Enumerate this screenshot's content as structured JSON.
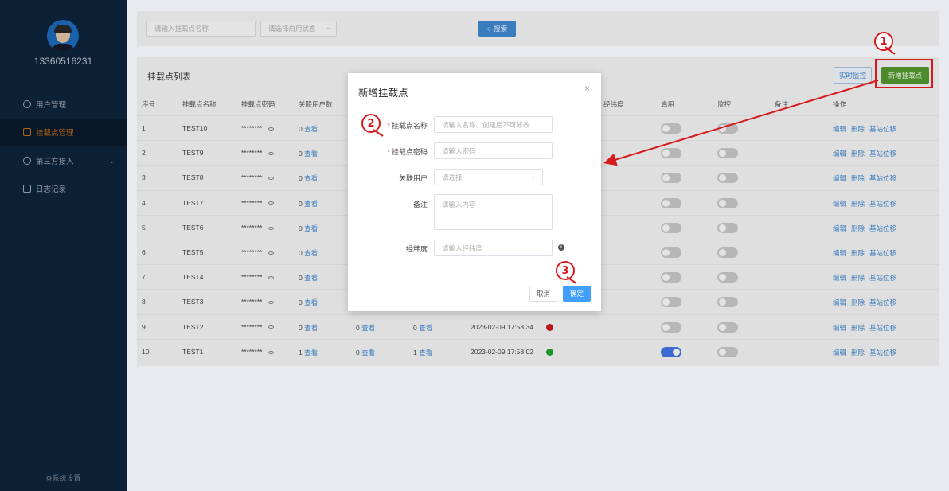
{
  "sidebar": {
    "phone": "13360516231",
    "items": [
      {
        "label": "用户管理",
        "icon": "user-icon"
      },
      {
        "label": "挂载点管理",
        "icon": "mount-icon"
      },
      {
        "label": "第三方接入",
        "icon": "globe-icon"
      },
      {
        "label": "日志记录",
        "icon": "log-icon"
      }
    ],
    "system_settings": "⚙系统设置"
  },
  "search": {
    "name_placeholder": "请输入挂载点名称",
    "status_placeholder": "请选择启用状态",
    "search_label": "搜索"
  },
  "list": {
    "title": "挂载点列表",
    "monitor_label": "实时监控",
    "add_label": "新增挂载点",
    "headers": [
      "序号",
      "挂载点名称",
      "挂载点密码",
      "关联用户数",
      "经纬度",
      "启用",
      "监控",
      "备注",
      "操作"
    ],
    "rows": [
      {
        "no": "1",
        "name": "TEST10",
        "pwd": "********",
        "users": "0",
        "view": "查看",
        "enabled": false
      },
      {
        "no": "2",
        "name": "TEST9",
        "pwd": "********",
        "users": "0",
        "view": "查看",
        "enabled": false
      },
      {
        "no": "3",
        "name": "TEST8",
        "pwd": "********",
        "users": "0",
        "view": "查看",
        "enabled": false
      },
      {
        "no": "4",
        "name": "TEST7",
        "pwd": "********",
        "users": "0",
        "view": "查看",
        "enabled": false
      },
      {
        "no": "5",
        "name": "TEST6",
        "pwd": "********",
        "users": "0",
        "view": "查看",
        "enabled": false
      },
      {
        "no": "6",
        "name": "TEST5",
        "pwd": "********",
        "users": "0",
        "view": "查看",
        "enabled": false
      },
      {
        "no": "7",
        "name": "TEST4",
        "pwd": "********",
        "users": "0",
        "view": "查看",
        "enabled": false
      },
      {
        "no": "8",
        "name": "TEST3",
        "pwd": "********",
        "users": "0",
        "view": "查看",
        "enabled": false
      },
      {
        "no": "9",
        "name": "TEST2",
        "pwd": "********",
        "users": "0",
        "view": "查看",
        "c5": "0",
        "c5view": "查看",
        "c6": "0",
        "c6view": "查看",
        "time": "2023-02-09 17:58:34",
        "status_color": "#c0181b",
        "enabled": false
      },
      {
        "no": "10",
        "name": "TEST1",
        "pwd": "********",
        "users": "1",
        "view": "查看",
        "c5": "0",
        "c5view": "查看",
        "c6": "1",
        "c6view": "查看",
        "time": "2023-02-09 17:58:02",
        "status_color": "#1a9a2a",
        "enabled": true
      }
    ],
    "actions": [
      "编辑",
      "删除",
      "基站位移"
    ]
  },
  "modal": {
    "title": "新增挂载点",
    "close": "×",
    "name_label": "挂载点名称",
    "name_placeholder": "请输入名称、创建后不可修改",
    "pwd_label": "挂载点密码",
    "pwd_placeholder": "请输入密码",
    "user_label": "关联用户",
    "user_placeholder": "请选择",
    "remark_label": "备注",
    "remark_placeholder": "请输入内容",
    "coord_label": "经纬度",
    "coord_placeholder": "请输入经纬度",
    "cancel_label": "取消",
    "ok_label": "确定"
  },
  "annotations": {
    "a1": "1",
    "a2": "2",
    "a3": "3",
    "color": "#d7191c"
  }
}
